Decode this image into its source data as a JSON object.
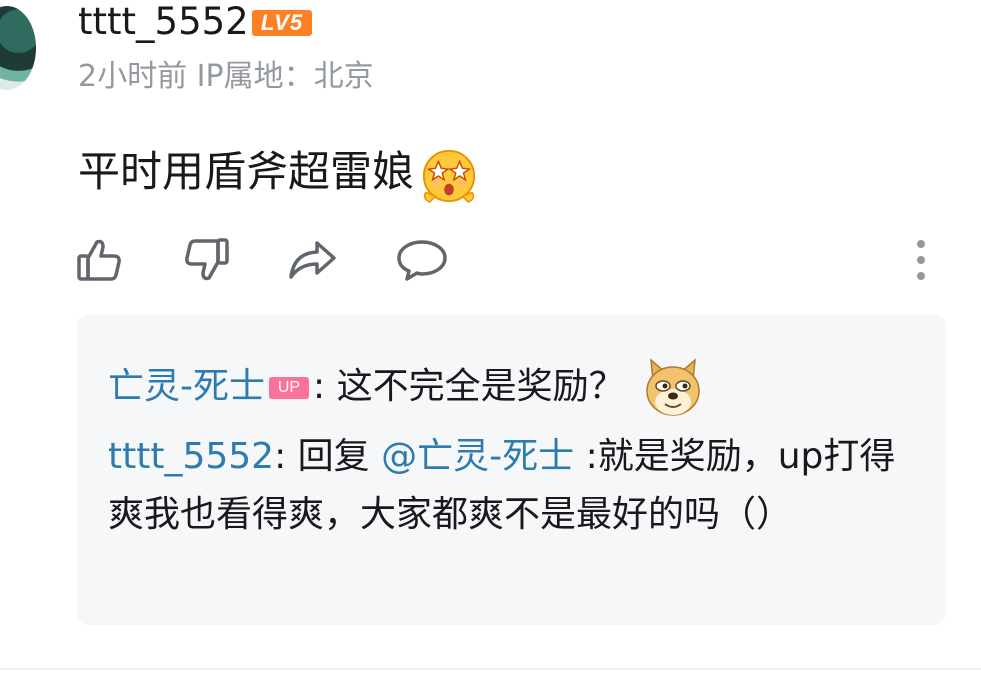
{
  "comment": {
    "username": "tttt_5552",
    "level": "LV5",
    "time": "2小时前",
    "ip_location": "IP属地：北京",
    "text": "平时用盾斧超雷娘",
    "emoji": "starry-eyed-face-emoji"
  },
  "actions": {
    "icons": [
      "thumbs-up-icon",
      "thumbs-down-icon",
      "share-icon",
      "comment-icon",
      "more-icon"
    ]
  },
  "replies": [
    {
      "author": "亡灵-死士",
      "badge": "UP",
      "separator": ":",
      "text": "这不完全是奖励？",
      "emoji": "doge-emoji"
    },
    {
      "author": "tttt_5552",
      "separator": ":",
      "prefix": "回复",
      "mention": "@亡灵-死士",
      "text": ":就是奖励，up打得爽我也看得爽，大家都爽不是最好的吗（）"
    }
  ],
  "colors": {
    "link": "#2e7bb0",
    "level_badge": "#ff7f24",
    "up_badge": "#fb7299",
    "meta_text": "#9499a0",
    "reply_bg": "#f6f7f8"
  }
}
